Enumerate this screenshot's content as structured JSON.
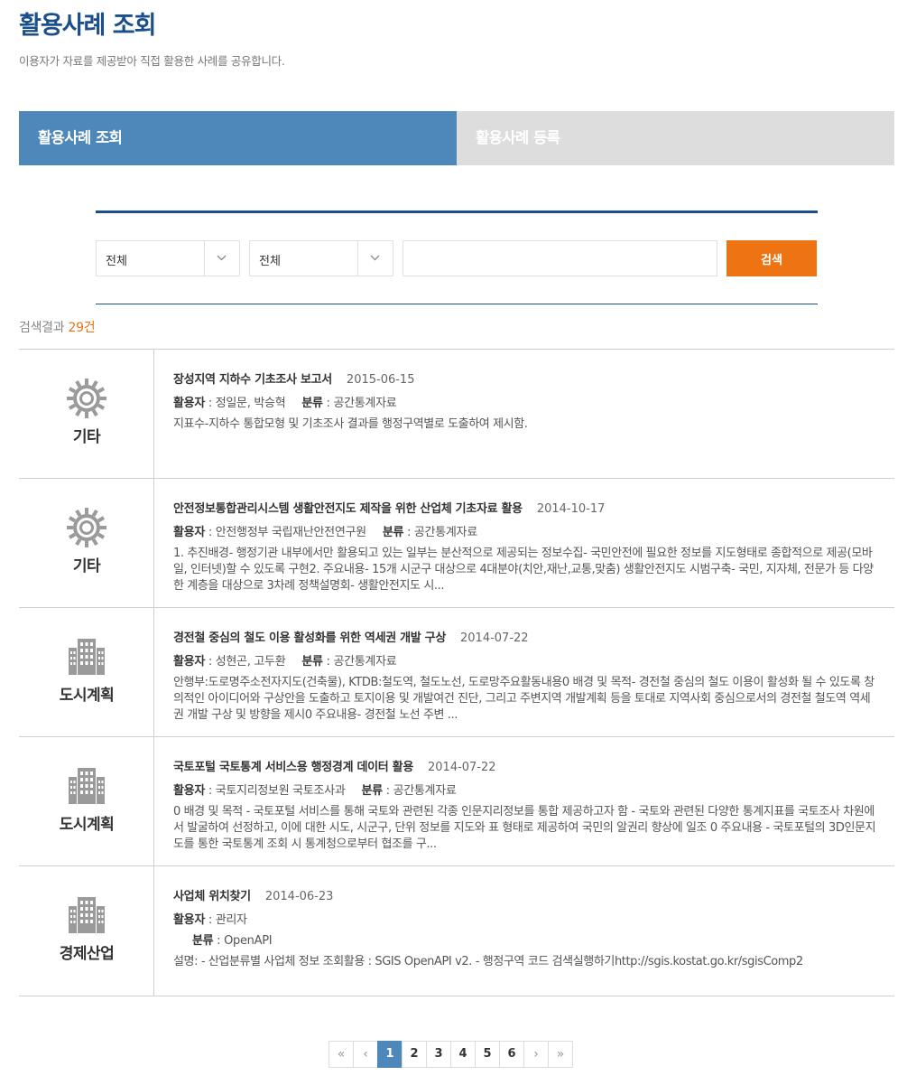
{
  "header": {
    "title": "활용사례 조회",
    "description": "이용자가 자료를 제공받아 직접 활용한 사례를 공유합니다."
  },
  "tabs": [
    {
      "label": "활용사례 조회",
      "active": true
    },
    {
      "label": "활용사례 등록",
      "active": false
    }
  ],
  "search": {
    "select1": "전체",
    "select2": "전체",
    "input_value": "",
    "button_label": "검색"
  },
  "results": {
    "label": "검색결과",
    "count": "29건"
  },
  "labels": {
    "user": "활용자",
    "category": "분류"
  },
  "items": [
    {
      "category": "기타",
      "icon": "gear-icon",
      "title": "장성지역 지하수 기초조사 보고서",
      "date": "2015-06-15",
      "user": "정일문, 박승혁",
      "class": "공간통계자료",
      "desc": "지표수-지하수 통합모형 및 기초조사 결과를 행정구역별로 도출하여 제시함."
    },
    {
      "category": "기타",
      "icon": "gear-icon",
      "title": "안전정보통합관리시스템 생활안전지도 제작을 위한 산업체 기초자료 활용",
      "date": "2014-10-17",
      "user": "안전행정부 국립재난안전연구원",
      "class": "공간통계자료",
      "desc": "1. 추진배경- 행정기관 내부에서만 활용되고 있는 일부는 분산적으로 제공되는 정보수집- 국민안전에 필요한 정보를 지도형태로 종합적으로 제공(모바일, 인터넷)할 수 있도록 구현2. 주요내용- 15개 시군구 대상으로 4대분야(치안,재난,교통,맞춤) 생활안전지도 시범구축- 국민, 지자체, 전문가 등 다양한 계층을 대상으로 3차례 정책설명회- 생활안전지도 시..."
    },
    {
      "category": "도시계획",
      "icon": "building-icon",
      "title": "경전철 중심의 철도 이용 활성화를 위한 역세권 개발 구상",
      "date": "2014-07-22",
      "user": "성현곤, 고두환",
      "class": "공간통계자료",
      "desc": "안행부:도로명주소전자지도(건축물), KTDB:철도역, 철도노선, 도로망주요활동내용0 배경 및 목적- 경전철 중심의 철도 이용이 활성화 될 수 있도록 창의적인 아이디어와 구상안을 도출하고 토지이용 및 개발여건 진단, 그리고 주변지역 개발계획 등을 토대로 지역사회 중심으로서의 경전철 철도역 역세권 개발 구상 및 방향을 제시0 주요내용- 경전철 노선 주변 ..."
    },
    {
      "category": "도시계획",
      "icon": "building-icon",
      "title": "국토포털 국토통계 서비스용 행정경계 데이터 활용",
      "date": "2014-07-22",
      "user": "국토지리정보원 국토조사과",
      "class": "공간통계자료",
      "desc": "0 배경 및 목적 - 국토포털 서비스를 통해 국토와 관련된 각종 인문지리정보를 통합 제공하고자 함 - 국토와 관련된 다양한 통계지표를 국토조사 차원에서 발굴하여 선정하고, 이에 대한 시도, 시군구, 단위 정보를 지도와 표 형태로 제공하여 국민의 알권리 향상에 일조 0 주요내용 - 국토포털의 3D인문지도를 통한 국토통계 조회 시 통계청으로부터 협조를 구..."
    },
    {
      "category": "경제산업",
      "icon": "building-icon",
      "title": "사업체 위치찾기",
      "date": "2014-06-23",
      "user": "관리자",
      "class": "OpenAPI",
      "desc": "설명: - 산업분류별 사업체 정보 조회활용 : SGIS OpenAPI v2. - 행정구역 코드 검색실행하기http://sgis.kostat.go.kr/sgisComp2"
    }
  ],
  "pagination": {
    "first": "«",
    "prev": "‹",
    "pages": [
      "1",
      "2",
      "3",
      "4",
      "5",
      "6"
    ],
    "current": "1",
    "next": "›",
    "last": "»"
  }
}
